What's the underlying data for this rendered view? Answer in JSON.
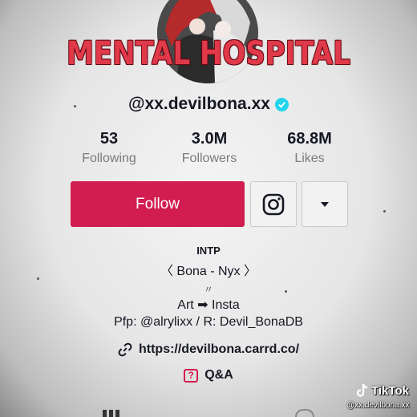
{
  "overlay": {
    "title": "MENTAL HOSPITAL"
  },
  "profile": {
    "username": "@xx.devilbona.xx",
    "verified": true
  },
  "stats": [
    {
      "value": "53",
      "label": "Following"
    },
    {
      "value": "3.0M",
      "label": "Followers"
    },
    {
      "value": "68.8M",
      "label": "Likes"
    }
  ],
  "actions": {
    "follow_label": "Follow",
    "instagram_icon": "instagram-icon",
    "dropdown_icon": "caret-down-icon"
  },
  "bio": {
    "type": "INTP",
    "line1": "〈 Bona - Nyx 〉",
    "line2": "〃",
    "line3": "Art ➡ Insta",
    "line4": "Pfp: @alrylixx / R: Devil_BonaDB"
  },
  "link": {
    "url": "https://devilbona.carrd.co/"
  },
  "qa": {
    "label": "Q&A",
    "icon_glyph": "?"
  },
  "watermark": {
    "brand": "TikTok",
    "handle": "@xx.devilbona.xx"
  },
  "colors": {
    "accent": "#d11d4f",
    "verified": "#20d5ec",
    "overlay_red": "#e0394a"
  }
}
